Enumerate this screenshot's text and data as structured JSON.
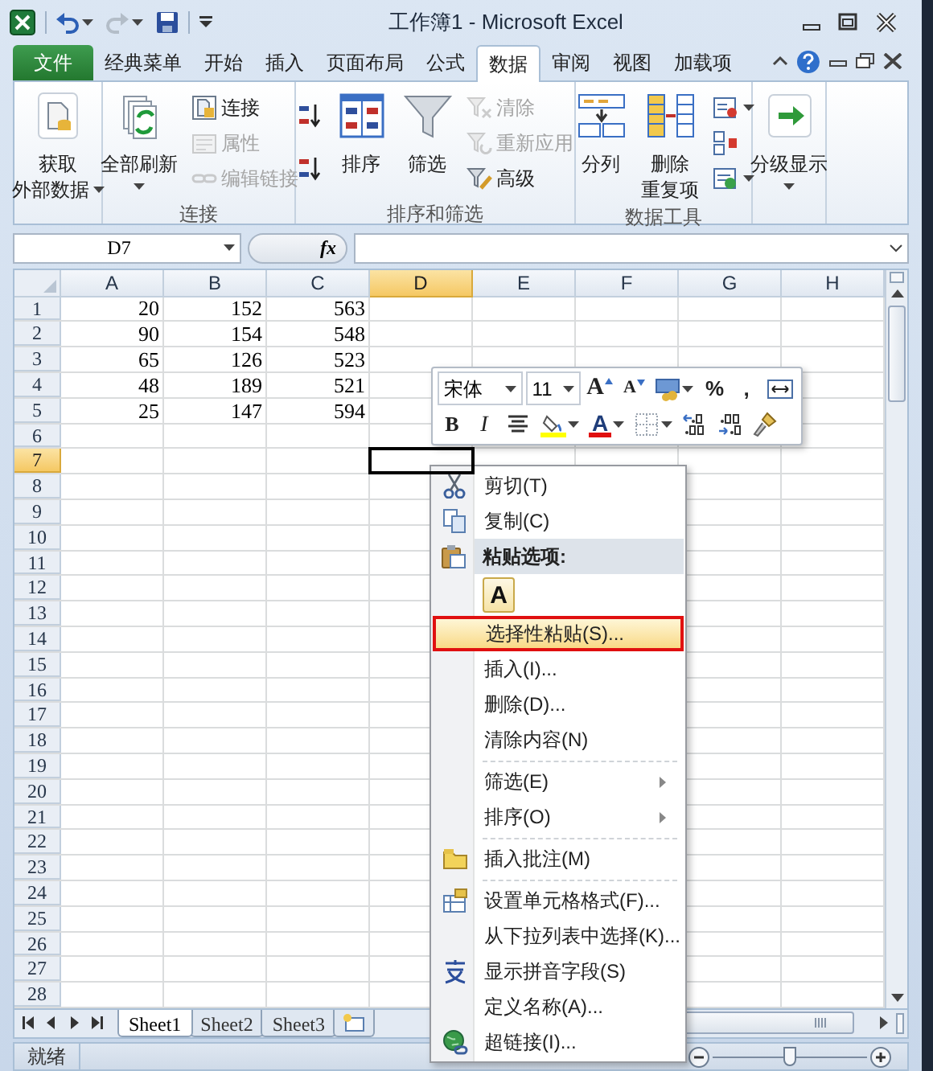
{
  "window": {
    "title": "工作簿1 - Microsoft Excel"
  },
  "ribbon_tabs": [
    {
      "label": "文件",
      "kind": "file",
      "selected": false
    },
    {
      "label": "经典菜单",
      "kind": "tab",
      "selected": false
    },
    {
      "label": "开始",
      "kind": "tab",
      "selected": false
    },
    {
      "label": "插入",
      "kind": "tab",
      "selected": false
    },
    {
      "label": "页面布局",
      "kind": "tab",
      "selected": false
    },
    {
      "label": "公式",
      "kind": "tab",
      "selected": false
    },
    {
      "label": "数据",
      "kind": "tab",
      "selected": true
    },
    {
      "label": "审阅",
      "kind": "tab",
      "selected": false
    },
    {
      "label": "视图",
      "kind": "tab",
      "selected": false
    },
    {
      "label": "加载项",
      "kind": "tab",
      "selected": false
    }
  ],
  "ribbon_groups": [
    {
      "items": [
        {
          "kind": "large",
          "lines": [
            "获取",
            "外部数据"
          ],
          "dropdown": true
        }
      ]
    },
    {
      "label": "连接",
      "items": [
        {
          "kind": "large",
          "lines": [
            "全部刷新"
          ],
          "dropdown": true
        },
        {
          "kind": "small",
          "label": "连接",
          "disabled": false,
          "dropdown": false
        },
        {
          "kind": "small",
          "label": "属性",
          "disabled": true,
          "dropdown": false
        },
        {
          "kind": "small",
          "label": "编辑链接",
          "disabled": true,
          "dropdown": false
        }
      ]
    },
    {
      "label": "排序和筛选",
      "items": [
        {
          "kind": "small",
          "disabled": false,
          "dropdown": false
        },
        {
          "kind": "small",
          "disabled": false,
          "dropdown": false
        },
        {
          "kind": "large",
          "lines": [
            "排序"
          ],
          "dropdown": false
        },
        {
          "kind": "large",
          "lines": [
            "筛选"
          ],
          "dropdown": false
        },
        {
          "kind": "small",
          "label": "清除",
          "disabled": true,
          "dropdown": false
        },
        {
          "kind": "small",
          "label": "重新应用",
          "disabled": true,
          "dropdown": false
        },
        {
          "kind": "small",
          "label": "高级",
          "disabled": false,
          "dropdown": false
        }
      ]
    },
    {
      "label": "数据工具",
      "items": [
        {
          "kind": "large",
          "lines": [
            "分列"
          ],
          "dropdown": false
        },
        {
          "kind": "large",
          "lines": [
            "删除",
            "重复项"
          ],
          "dropdown": false
        },
        {
          "kind": "small",
          "disabled": false,
          "dropdown": true
        },
        {
          "kind": "small",
          "disabled": false,
          "dropdown": false
        },
        {
          "kind": "small",
          "disabled": false,
          "dropdown": true
        }
      ]
    },
    {
      "items": [
        {
          "kind": "large",
          "lines": [
            "分级显示"
          ],
          "dropdown": true
        }
      ]
    }
  ],
  "formula_bar": {
    "name_box": "D7",
    "function_label": "fx"
  },
  "columns": [
    {
      "label": "A",
      "selected": false
    },
    {
      "label": "B",
      "selected": false
    },
    {
      "label": "C",
      "selected": false
    },
    {
      "label": "D",
      "selected": true
    },
    {
      "label": "E",
      "selected": false
    },
    {
      "label": "F",
      "selected": false
    },
    {
      "label": "G",
      "selected": false
    },
    {
      "label": "H",
      "selected": false
    }
  ],
  "rows": [
    {
      "header": "1",
      "selected": false,
      "cells": [
        "20",
        "152",
        "563"
      ]
    },
    {
      "header": "2",
      "selected": false,
      "cells": [
        "90",
        "154",
        "548"
      ]
    },
    {
      "header": "3",
      "selected": false,
      "cells": [
        "65",
        "126",
        "523"
      ]
    },
    {
      "header": "4",
      "selected": false,
      "cells": [
        "48",
        "189",
        "521"
      ]
    },
    {
      "header": "5",
      "selected": false,
      "cells": [
        "25",
        "147",
        "594"
      ]
    },
    {
      "header": "6",
      "selected": false
    },
    {
      "header": "7",
      "selected": true
    },
    {
      "header": "8",
      "selected": false
    },
    {
      "header": "9",
      "selected": false
    },
    {
      "header": "10",
      "selected": false
    },
    {
      "header": "11",
      "selected": false
    },
    {
      "header": "12",
      "selected": false
    },
    {
      "header": "13",
      "selected": false
    },
    {
      "header": "14",
      "selected": false
    },
    {
      "header": "15",
      "selected": false
    },
    {
      "header": "16",
      "selected": false
    },
    {
      "header": "17",
      "selected": false
    },
    {
      "header": "18",
      "selected": false
    },
    {
      "header": "19",
      "selected": false
    },
    {
      "header": "20",
      "selected": false
    },
    {
      "header": "21",
      "selected": false
    },
    {
      "header": "22",
      "selected": false
    },
    {
      "header": "23",
      "selected": false
    },
    {
      "header": "24",
      "selected": false
    },
    {
      "header": "25",
      "selected": false
    },
    {
      "header": "26",
      "selected": false
    },
    {
      "header": "27",
      "selected": false
    },
    {
      "header": "28",
      "selected": false
    }
  ],
  "mini_toolbar": {
    "rows": [
      [
        {
          "kind": "combo",
          "value": "宋体"
        },
        {
          "kind": "combo",
          "value": "11"
        },
        {
          "kind": "grow",
          "text": "A"
        },
        {
          "kind": "shrink",
          "text": "A"
        },
        {
          "kind": "icon",
          "dropdown": true
        },
        {
          "kind": "glyph",
          "text": "%"
        },
        {
          "kind": "glyph",
          "text": ","
        },
        {
          "kind": "icon",
          "dropdown": false
        }
      ],
      [
        {
          "kind": "bold",
          "text": "B"
        },
        {
          "kind": "italic",
          "text": "I"
        },
        {
          "kind": "icon",
          "dropdown": false
        },
        {
          "kind": "icon",
          "dropdown": true
        },
        {
          "kind": "font-color",
          "text": "A",
          "dropdown": true
        },
        {
          "kind": "icon",
          "dropdown": true
        },
        {
          "kind": "icon",
          "dropdown": false
        },
        {
          "kind": "icon",
          "dropdown": false
        },
        {
          "kind": "icon",
          "dropdown": false
        }
      ]
    ]
  },
  "context_menu": {
    "items": [
      {
        "kind": "item",
        "label": "剪切(T)",
        "selected": false,
        "outlined": false,
        "submenu": false
      },
      {
        "kind": "item",
        "label": "复制(C)",
        "selected": false,
        "outlined": false,
        "submenu": false
      },
      {
        "kind": "header",
        "label": "粘贴选项:"
      },
      {
        "kind": "paste-option",
        "text": "A"
      },
      {
        "kind": "item",
        "label": "选择性粘贴(S)...",
        "selected": true,
        "outlined": true,
        "submenu": false
      },
      {
        "kind": "item",
        "label": "插入(I)...",
        "selected": false,
        "outlined": false,
        "submenu": false
      },
      {
        "kind": "item",
        "label": "删除(D)...",
        "selected": false,
        "outlined": false,
        "submenu": false
      },
      {
        "kind": "item",
        "label": "清除内容(N)",
        "selected": false,
        "outlined": false,
        "submenu": false
      },
      {
        "kind": "separator"
      },
      {
        "kind": "item",
        "label": "筛选(E)",
        "selected": false,
        "outlined": false,
        "submenu": true
      },
      {
        "kind": "item",
        "label": "排序(O)",
        "selected": false,
        "outlined": false,
        "submenu": true
      },
      {
        "kind": "separator"
      },
      {
        "kind": "item",
        "label": "插入批注(M)",
        "selected": false,
        "outlined": false,
        "submenu": false
      },
      {
        "kind": "separator"
      },
      {
        "kind": "item",
        "label": "设置单元格格式(F)...",
        "selected": false,
        "outlined": false,
        "submenu": false
      },
      {
        "kind": "item",
        "label": "从下拉列表中选择(K)...",
        "selected": false,
        "outlined": false,
        "submenu": false
      },
      {
        "kind": "item",
        "label": "显示拼音字段(S)",
        "selected": false,
        "outlined": false,
        "submenu": false
      },
      {
        "kind": "item",
        "label": "定义名称(A)...",
        "selected": false,
        "outlined": false,
        "submenu": false
      },
      {
        "kind": "item",
        "label": "超链接(I)...",
        "selected": false,
        "outlined": false,
        "submenu": false
      }
    ]
  },
  "sheet_tabs": [
    {
      "label": "Sheet1",
      "selected": true
    },
    {
      "label": "Sheet2",
      "selected": false
    },
    {
      "label": "Sheet3",
      "selected": false
    }
  ],
  "status_bar": {
    "text": "就绪",
    "zoom_slider": {
      "level": 0.5
    }
  }
}
